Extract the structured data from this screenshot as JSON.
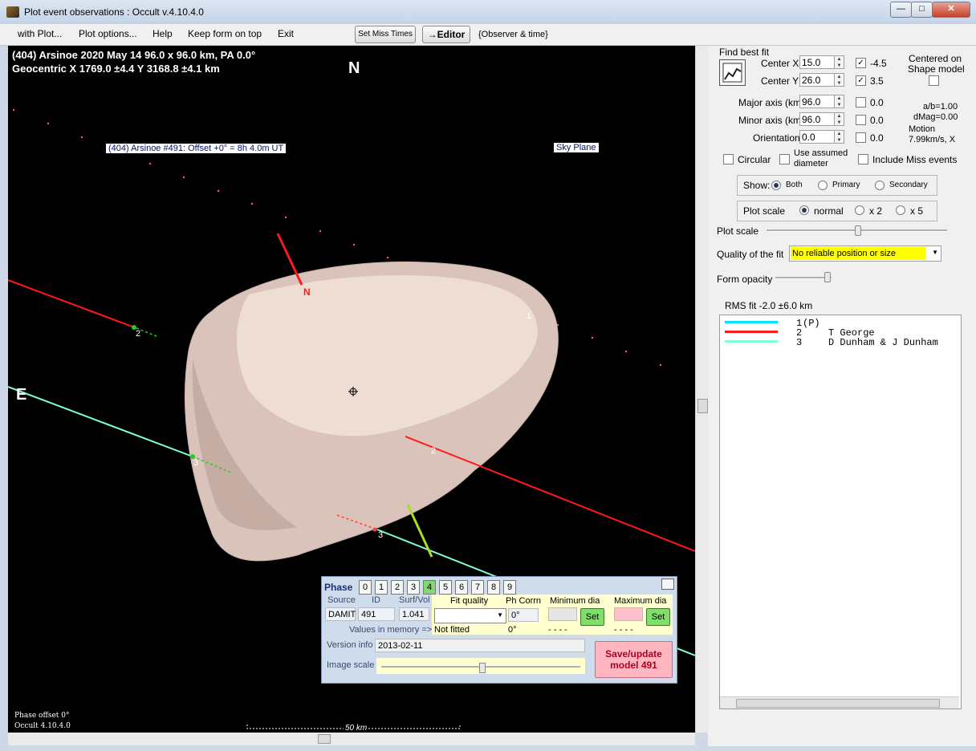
{
  "window": {
    "title": "Plot event observations : Occult v.4.10.4.0",
    "minimize": "—",
    "maximize": "□",
    "close": "✕"
  },
  "menu": {
    "items": [
      "with Plot...",
      "Plot options...",
      "Help",
      "Keep form on top",
      "Exit"
    ],
    "set_miss_times": "Set Miss Times",
    "editor": "→Editor",
    "observer_time": "{Observer & time}"
  },
  "plot": {
    "header_line1": "(404) Arsinoe  2020 May 14  96.0 x 96.0 km, PA 0.0°",
    "header_line2": "Geocentric  X  1769.0 ±4.4  Y 3168.8 ±4.1 km",
    "north": "N",
    "east": "E",
    "model_label": "(404) Arsinoe #491: Offset  +0° =  8h  4.0m UT",
    "sky_plane": "Sky Plane",
    "north_arrow_label": "N",
    "chord_labels": [
      "1",
      "2",
      "3",
      "2",
      "3"
    ],
    "phase_offset": "Phase offset 0°",
    "version": "Occult 4.10.4.0",
    "scale_bar": "50 km"
  },
  "fit": {
    "find_best_fit": "Find best fit",
    "center_x_label": "Center X",
    "center_x": "15.0",
    "center_x_checked": true,
    "center_x_unc": "-4.5",
    "center_y_label": "Center Y",
    "center_y": "26.0",
    "center_y_checked": true,
    "center_y_unc": "3.5",
    "centered_on": "Centered on",
    "shape_model": "Shape model",
    "major_label": "Major axis (km)",
    "major": "96.0",
    "major_unc": "0.0",
    "minor_label": "Minor axis (km)",
    "minor": "96.0",
    "minor_unc": "0.0",
    "orient_label": "Orientation",
    "orient": "0.0",
    "orient_unc": "0.0",
    "ab": "a/b=1.00",
    "dmag": "dMag=0.00",
    "motion": "Motion",
    "motion_val": "7.99km/s, X",
    "circular": "Circular",
    "use_assumed_1": "Use assumed",
    "use_assumed_2": "diameter",
    "include_miss": "Include Miss events",
    "show_label": "Show:",
    "show_both": "Both",
    "show_primary": "Primary",
    "show_secondary": "Secondary",
    "plot_scale_label": "Plot scale",
    "scale_normal": "normal",
    "scale_x2": "x 2",
    "scale_x5": "x 5",
    "plot_scale_slider_label": "Plot scale",
    "quality_label": "Quality of the fit",
    "quality_value": "No reliable position or size",
    "form_opacity": "Form opacity",
    "rms": "RMS fit -2.0 ±6.0 km"
  },
  "legend": [
    {
      "num": "1",
      "name": "(P)",
      "color": "#00e5ff"
    },
    {
      "num": "2",
      "name": "T George",
      "color": "#ff1a1a"
    },
    {
      "num": "3",
      "name": "D Dunham & J Dunham",
      "color": "#7fffd4"
    }
  ],
  "phase_panel": {
    "title": "Phase",
    "buttons": [
      "0",
      "1",
      "2",
      "3",
      "4",
      "5",
      "6",
      "7",
      "8",
      "9"
    ],
    "selected": 4,
    "source_label": "Source",
    "id_label": "ID",
    "surfvol_label": "Surf/Vol",
    "source": "DAMIT",
    "id": "491",
    "surfvol": "1.041",
    "fit_quality": "Fit quality",
    "ph_corr": "Ph Corrn",
    "min_dia": "Minimum dia",
    "max_dia": "Maximum dia",
    "ph_corr_val": "0°",
    "values_in_memory": "Values in memory =>",
    "not_fitted": "Not fitted",
    "ph_corr_mem": "0°",
    "dashes1": "- - - -",
    "dashes2": "- - - -",
    "set": "Set",
    "version_info_label": "Version info",
    "version_info": "2013-02-11",
    "image_scale_label": "Image scale",
    "save_line1": "Save/update",
    "save_line2": "model 491"
  },
  "colors": {
    "chord_cyan": "#00e5ff",
    "chord_red": "#ff1a1a",
    "chord_aqua": "#7fffd4",
    "asteroid": "#e9d6cc"
  }
}
